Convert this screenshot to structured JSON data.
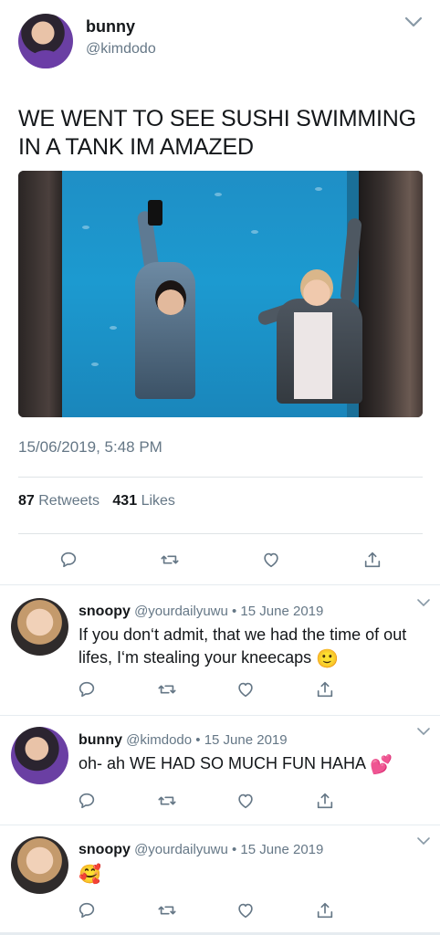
{
  "tweet": {
    "display_name": "bunny",
    "handle": "@kimdodo",
    "text": "WE WENT TO SEE SUSHI SWIMMING IN A TANK IM AMAZED",
    "timestamp": "15/06/2019, 5:48 PM",
    "retweet_count": "87",
    "retweet_label": "Retweets",
    "like_count": "431",
    "like_label": "Likes",
    "menu_icon": "chevron-down-icon",
    "actions": [
      "reply-icon",
      "retweet-icon",
      "like-icon",
      "share-icon"
    ]
  },
  "replies": [
    {
      "name": "snoopy",
      "handle": "@yourdailyuwu",
      "date": "• 15 June 2019",
      "text": "If you don‘t admit, that we had the time of out lifes, I‘m stealing your kneecaps",
      "emoji": "🙂"
    },
    {
      "name": "bunny",
      "handle": "@kimdodo",
      "date": "• 15 June 2019",
      "text": "oh- ah WE HAD SO MUCH FUN HAHA",
      "emoji": "💕"
    },
    {
      "name": "snoopy",
      "handle": "@yourdailyuwu",
      "date": "• 15 June 2019",
      "text": "",
      "emoji": "🥰"
    }
  ],
  "colors": {
    "text_primary": "#14171a",
    "text_secondary": "#657786",
    "divider": "#e6ecf0",
    "icon": "#657786"
  }
}
